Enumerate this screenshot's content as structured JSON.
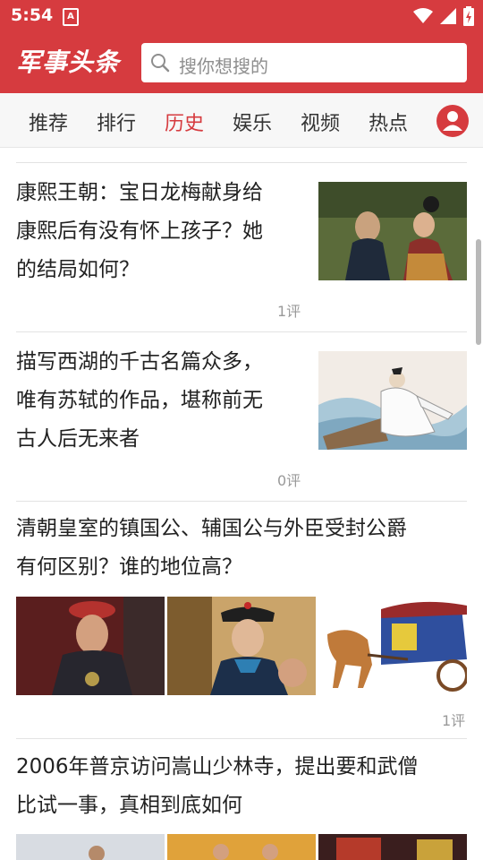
{
  "status": {
    "time": "5:54",
    "notif_glyph": "A"
  },
  "app": {
    "logo": "军事头条",
    "search_placeholder": "搜你想搜的"
  },
  "tabs": [
    "推荐",
    "排行",
    "历史",
    "娱乐",
    "视频",
    "热点"
  ],
  "active_tab": "历史",
  "feed": [
    {
      "title_lines": [
        "康熙王朝：宝日龙梅献身给",
        "康熙后有没有怀上孩子？她",
        "的结局如何？"
      ],
      "comments": "1评"
    },
    {
      "title_lines": [
        "描写西湖的千古名篇众多，",
        "唯有苏轼的作品，堪称前无",
        "古人后无来者"
      ],
      "comments": "0评"
    },
    {
      "title_lines": [
        "清朝皇室的镇国公、辅国公与外臣受封公爵",
        "有何区别？谁的地位高？"
      ],
      "comments": "1评"
    },
    {
      "title_lines": [
        "2006年普京访问嵩山少林寺，提出要和武僧",
        "比试一事，真相到底如何"
      ]
    }
  ],
  "colors": {
    "brand": "#d63b3f",
    "active_tab": "#d63b3f",
    "text": "#222222",
    "muted": "#999999"
  },
  "icons": [
    "search-icon",
    "user-icon",
    "wifi-icon",
    "signal-icon",
    "battery-icon"
  ]
}
